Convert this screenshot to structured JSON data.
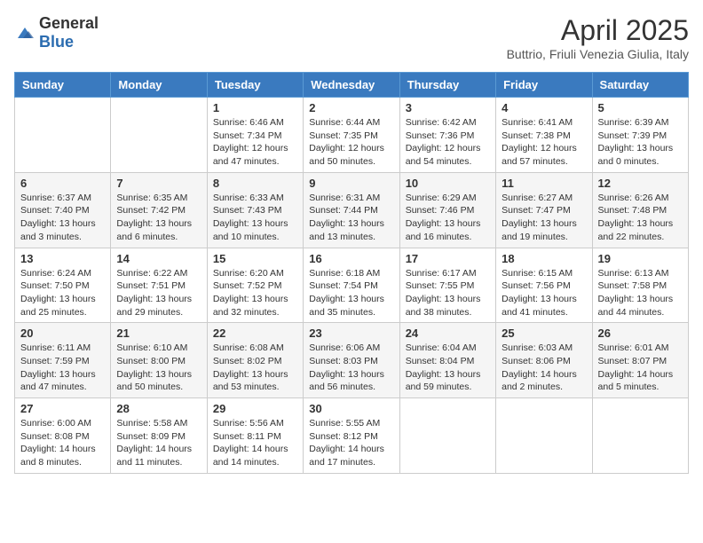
{
  "header": {
    "logo_general": "General",
    "logo_blue": "Blue",
    "title": "April 2025",
    "subtitle": "Buttrio, Friuli Venezia Giulia, Italy"
  },
  "days_of_week": [
    "Sunday",
    "Monday",
    "Tuesday",
    "Wednesday",
    "Thursday",
    "Friday",
    "Saturday"
  ],
  "weeks": [
    [
      {
        "day": "",
        "info": ""
      },
      {
        "day": "",
        "info": ""
      },
      {
        "day": "1",
        "info": "Sunrise: 6:46 AM\nSunset: 7:34 PM\nDaylight: 12 hours and 47 minutes."
      },
      {
        "day": "2",
        "info": "Sunrise: 6:44 AM\nSunset: 7:35 PM\nDaylight: 12 hours and 50 minutes."
      },
      {
        "day": "3",
        "info": "Sunrise: 6:42 AM\nSunset: 7:36 PM\nDaylight: 12 hours and 54 minutes."
      },
      {
        "day": "4",
        "info": "Sunrise: 6:41 AM\nSunset: 7:38 PM\nDaylight: 12 hours and 57 minutes."
      },
      {
        "day": "5",
        "info": "Sunrise: 6:39 AM\nSunset: 7:39 PM\nDaylight: 13 hours and 0 minutes."
      }
    ],
    [
      {
        "day": "6",
        "info": "Sunrise: 6:37 AM\nSunset: 7:40 PM\nDaylight: 13 hours and 3 minutes."
      },
      {
        "day": "7",
        "info": "Sunrise: 6:35 AM\nSunset: 7:42 PM\nDaylight: 13 hours and 6 minutes."
      },
      {
        "day": "8",
        "info": "Sunrise: 6:33 AM\nSunset: 7:43 PM\nDaylight: 13 hours and 10 minutes."
      },
      {
        "day": "9",
        "info": "Sunrise: 6:31 AM\nSunset: 7:44 PM\nDaylight: 13 hours and 13 minutes."
      },
      {
        "day": "10",
        "info": "Sunrise: 6:29 AM\nSunset: 7:46 PM\nDaylight: 13 hours and 16 minutes."
      },
      {
        "day": "11",
        "info": "Sunrise: 6:27 AM\nSunset: 7:47 PM\nDaylight: 13 hours and 19 minutes."
      },
      {
        "day": "12",
        "info": "Sunrise: 6:26 AM\nSunset: 7:48 PM\nDaylight: 13 hours and 22 minutes."
      }
    ],
    [
      {
        "day": "13",
        "info": "Sunrise: 6:24 AM\nSunset: 7:50 PM\nDaylight: 13 hours and 25 minutes."
      },
      {
        "day": "14",
        "info": "Sunrise: 6:22 AM\nSunset: 7:51 PM\nDaylight: 13 hours and 29 minutes."
      },
      {
        "day": "15",
        "info": "Sunrise: 6:20 AM\nSunset: 7:52 PM\nDaylight: 13 hours and 32 minutes."
      },
      {
        "day": "16",
        "info": "Sunrise: 6:18 AM\nSunset: 7:54 PM\nDaylight: 13 hours and 35 minutes."
      },
      {
        "day": "17",
        "info": "Sunrise: 6:17 AM\nSunset: 7:55 PM\nDaylight: 13 hours and 38 minutes."
      },
      {
        "day": "18",
        "info": "Sunrise: 6:15 AM\nSunset: 7:56 PM\nDaylight: 13 hours and 41 minutes."
      },
      {
        "day": "19",
        "info": "Sunrise: 6:13 AM\nSunset: 7:58 PM\nDaylight: 13 hours and 44 minutes."
      }
    ],
    [
      {
        "day": "20",
        "info": "Sunrise: 6:11 AM\nSunset: 7:59 PM\nDaylight: 13 hours and 47 minutes."
      },
      {
        "day": "21",
        "info": "Sunrise: 6:10 AM\nSunset: 8:00 PM\nDaylight: 13 hours and 50 minutes."
      },
      {
        "day": "22",
        "info": "Sunrise: 6:08 AM\nSunset: 8:02 PM\nDaylight: 13 hours and 53 minutes."
      },
      {
        "day": "23",
        "info": "Sunrise: 6:06 AM\nSunset: 8:03 PM\nDaylight: 13 hours and 56 minutes."
      },
      {
        "day": "24",
        "info": "Sunrise: 6:04 AM\nSunset: 8:04 PM\nDaylight: 13 hours and 59 minutes."
      },
      {
        "day": "25",
        "info": "Sunrise: 6:03 AM\nSunset: 8:06 PM\nDaylight: 14 hours and 2 minutes."
      },
      {
        "day": "26",
        "info": "Sunrise: 6:01 AM\nSunset: 8:07 PM\nDaylight: 14 hours and 5 minutes."
      }
    ],
    [
      {
        "day": "27",
        "info": "Sunrise: 6:00 AM\nSunset: 8:08 PM\nDaylight: 14 hours and 8 minutes."
      },
      {
        "day": "28",
        "info": "Sunrise: 5:58 AM\nSunset: 8:09 PM\nDaylight: 14 hours and 11 minutes."
      },
      {
        "day": "29",
        "info": "Sunrise: 5:56 AM\nSunset: 8:11 PM\nDaylight: 14 hours and 14 minutes."
      },
      {
        "day": "30",
        "info": "Sunrise: 5:55 AM\nSunset: 8:12 PM\nDaylight: 14 hours and 17 minutes."
      },
      {
        "day": "",
        "info": ""
      },
      {
        "day": "",
        "info": ""
      },
      {
        "day": "",
        "info": ""
      }
    ]
  ]
}
